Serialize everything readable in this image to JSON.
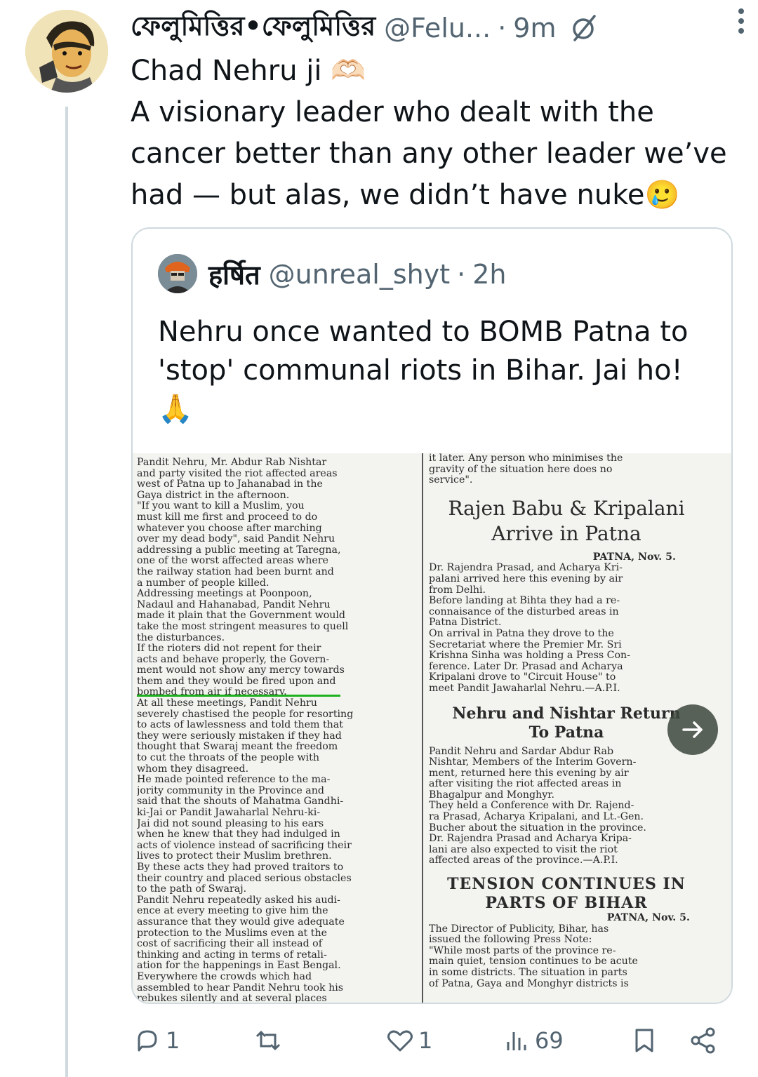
{
  "author": {
    "display_name": "ফেলুমিত্তির•ফেলুমিত্তির",
    "handle": "@Felu...",
    "separator": "·",
    "time": "9m"
  },
  "tweet": {
    "lines": [
      "Chad Nehru ji 🫶🏻",
      "A visionary leader who dealt with the",
      "cancer better than any other leader we’ve",
      "had — but alas, we didn’t have nuke🥲"
    ]
  },
  "quoted": {
    "display_name": "हर्षित",
    "handle": "@unreal_shyt",
    "separator": "·",
    "time": "2h",
    "lines": [
      "Nehru once wanted to BOMB Patna to",
      "'stop' communal riots in Bihar. Jai ho!",
      "🙏"
    ]
  },
  "newspaper": {
    "left_column": [
      "  Pandit Nehru, Mr. Abdur Rab Nishtar",
      "and party visited the riot affected areas",
      "west of Patna up to Jahanabad in the",
      "Gaya district in the afternoon.",
      "  \"If you want to kill a Muslim, you",
      "  must kill me first and proceed to do",
      "  whatever you choose after marching",
      "  over my dead body\", said Pandit Nehru",
      "  addressing a public meeting at Taregna,",
      "  one of the worst affected areas where",
      "  the railway station had been burnt and",
      "  a number of people killed.",
      "  Addressing meetings at Poonpoon,",
      "Nadaul and Hahanabad, Pandit Nehru",
      "made it plain that the Government would",
      "take the most stringent measures to quell",
      "the disturbances.",
      "  If the rioters did not repent for their",
      "acts and behave properly, the Govern-",
      "ment would not show any mercy towards",
      "them and they would be fired upon and",
      "bombed from air if necessary.",
      "  At all these meetings, Pandit Nehru",
      "severely chastised the people for resorting",
      "to acts of lawlessness and told them that",
      "they were seriously mistaken if they had",
      "thought that Swaraj meant the freedom",
      "to cut the throats of the people with",
      "whom they disagreed.",
      "  He made pointed reference to the ma-",
      "jority community in the Province and",
      "said that the shouts of Mahatma Gandhi-",
      "ki-Jai or Pandit Jawaharlal Nehru-ki-",
      "Jai did not sound pleasing to his ears",
      "when he knew that they had indulged in",
      "acts of violence instead of sacrificing their",
      "lives to protect their Muslim brethren.",
      "By these acts they had proved traitors to",
      "their country and placed serious obstacles",
      "to the path of Swaraj.",
      "  Pandit Nehru repeatedly asked his audi-",
      "ence at every meeting to give him the",
      "assurance that they would give adequate",
      "protection to the Muslims even at the",
      "cost of sacrificing their all instead of",
      "thinking and acting in terms of retali-",
      "ation for the happenings in East Bengal.",
      "  Everywhere the crowds which had",
      "assembled to hear Pandit Nehru took his",
      "rebukes silently and at several places"
    ],
    "right_top": [
      "it later. Any person who minimises the",
      "gravity of the situation here does no",
      "service\"."
    ],
    "headline1": [
      "Rajen Babu & Kripalani",
      "Arrive in Patna"
    ],
    "dateline1": "PATNA, Nov. 5.",
    "story1": [
      "  Dr. Rajendra Prasad, and Acharya Kri-",
      "palani arrived here this evening by air",
      "from Delhi.",
      "  Before landing at Bihta they had a re-",
      "connaisance of the disturbed areas in",
      "Patna District.",
      "  On arrival in Patna they drove to the",
      "Secretariat where the Premier Mr. Sri",
      "Krishna Sinha was holding a Press Con-",
      "ference. Later Dr. Prasad and Acharya",
      "Kripalani drove to \"Circuit House\" to",
      "meet Pandit Jawaharlal Nehru.—A.P.I."
    ],
    "headline2": [
      "Nehru and Nishtar Return",
      "To Patna"
    ],
    "story2": [
      "  Pandit Nehru and Sardar Abdur Rab",
      "Nishtar, Members of the Interim Govern-",
      "ment, returned here this evening by air",
      "after visiting the riot affected areas in",
      "Bhagalpur and Monghyr.",
      "  They held a Conference with Dr. Rajend-",
      "ra Prasad, Acharya Kripalani, and Lt.-Gen.",
      "Bucher about the situation in the province.",
      "  Dr. Rajendra Prasad and Acharya Kripa-",
      "lani are also expected to visit the riot",
      "affected areas of the province.—A.P.I."
    ],
    "headline3": [
      "TENSION CONTINUES IN",
      "PARTS OF BIHAR"
    ],
    "dateline3": "PATNA, Nov. 5.",
    "story3": [
      "  The Director of Publicity, Bihar, has",
      "issued the following Press Note:",
      "  \"While most parts of the province re-",
      "main quiet, tension continues to be acute",
      "in some districts. The situation in parts",
      "of Patna, Gaya and Monghyr districts is"
    ]
  },
  "actions": {
    "replies": "1",
    "reposts": "",
    "likes": "1",
    "views": "69"
  },
  "colors": {
    "text": "#0f1419",
    "secondary": "#536471",
    "border": "#cfd9de",
    "highlight": "#1db21d"
  }
}
